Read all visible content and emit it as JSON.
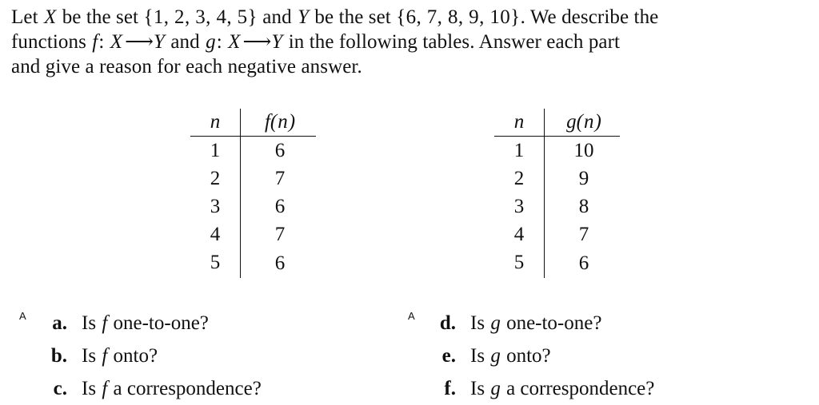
{
  "problem": {
    "lines": [
      {
        "parts": [
          {
            "t": "Let ",
            "k": "plain"
          },
          {
            "t": "X",
            "k": "var"
          },
          {
            "t": " be the set ",
            "k": "plain"
          },
          {
            "t": "{1, 2, 3, 4, 5}",
            "k": "num"
          },
          {
            "t": " and ",
            "k": "plain"
          },
          {
            "t": "Y",
            "k": "var"
          },
          {
            "t": " be the set ",
            "k": "plain"
          },
          {
            "t": "{6, 7, 8, 9, 10}",
            "k": "num"
          },
          {
            "t": ".  We describe the",
            "k": "plain"
          }
        ]
      },
      {
        "parts": [
          {
            "t": "functions ",
            "k": "plain"
          },
          {
            "t": "f",
            "k": "var"
          },
          {
            "t": ": ",
            "k": "plain"
          },
          {
            "t": "X",
            "k": "var"
          },
          {
            "t": "⟶",
            "k": "arrow"
          },
          {
            "t": "Y",
            "k": "var"
          },
          {
            "t": " and ",
            "k": "plain"
          },
          {
            "t": "g",
            "k": "var"
          },
          {
            "t": ": ",
            "k": "plain"
          },
          {
            "t": "X",
            "k": "var"
          },
          {
            "t": "⟶",
            "k": "arrow"
          },
          {
            "t": "Y",
            "k": "var"
          },
          {
            "t": " in the following tables.  Answer each part",
            "k": "plain"
          }
        ]
      },
      {
        "parts": [
          {
            "t": "and give a reason for each negative answer.",
            "k": "plain"
          }
        ]
      }
    ]
  },
  "tables": [
    {
      "id": "f",
      "headers": {
        "n": "n",
        "value_fn": "f",
        "value_arg": "(n)"
      },
      "rows": [
        {
          "n": "1",
          "v": "6"
        },
        {
          "n": "2",
          "v": "7"
        },
        {
          "n": "3",
          "v": "6"
        },
        {
          "n": "4",
          "v": "7"
        },
        {
          "n": "5",
          "v": "6"
        }
      ]
    },
    {
      "id": "g",
      "headers": {
        "n": "n",
        "value_fn": "g",
        "value_arg": "(n)"
      },
      "rows": [
        {
          "n": "1",
          "v": "10"
        },
        {
          "n": "2",
          "v": "9"
        },
        {
          "n": "3",
          "v": "8"
        },
        {
          "n": "4",
          "v": "7"
        },
        {
          "n": "5",
          "v": "6"
        }
      ]
    }
  ],
  "questions": {
    "left": [
      {
        "sup": "A",
        "marker": "a.",
        "pre": "Is ",
        "fn": "f",
        "post": " one-to-one?"
      },
      {
        "sup": "",
        "marker": "b.",
        "pre": "Is ",
        "fn": "f",
        "post": " onto?"
      },
      {
        "sup": "",
        "marker": "c.",
        "pre": "Is ",
        "fn": "f",
        "post": " a correspondence?"
      }
    ],
    "right": [
      {
        "sup": "A",
        "marker": "d.",
        "pre": "Is ",
        "fn": "g",
        "post": " one-to-one?"
      },
      {
        "sup": "",
        "marker": "e.",
        "pre": "Is ",
        "fn": "g",
        "post": " onto?"
      },
      {
        "sup": "",
        "marker": "f.",
        "pre": "Is ",
        "fn": "g",
        "post": " a correspondence?"
      }
    ]
  },
  "colors": {
    "text": "#111111",
    "background": "#ffffff",
    "rule": "#111111"
  }
}
